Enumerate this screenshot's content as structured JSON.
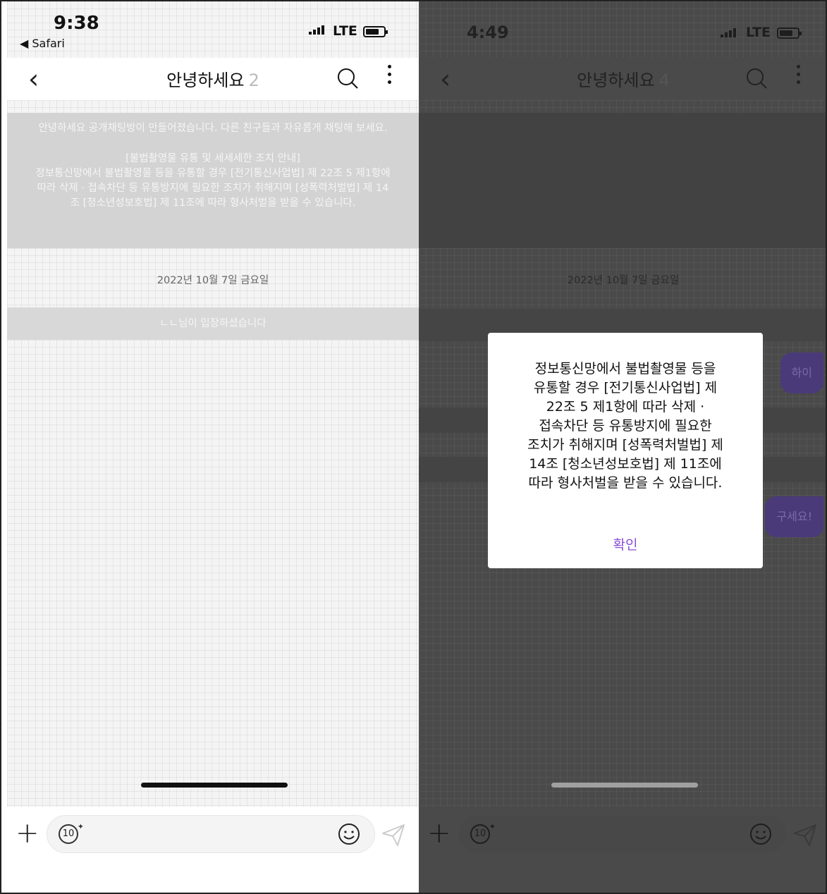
{
  "left_screen": {
    "status": {
      "time": "9:38",
      "back_app": "◀ Safari",
      "network": "LTE"
    },
    "nav": {
      "back_icon": "chevron-left-icon",
      "title": "안녕하세요",
      "member_count": "2"
    },
    "notice": {
      "line1": "안녕하세요 공개채팅방이 만들어졌습니다. 다른 친구들과 자유롭게 채팅해 보세요.",
      "heading": "[불법촬영물 유통 및 세세세한 조치 안내]",
      "body": "정보통신망에서 불법촬영물 등을 유통할 경우 [전기통신사업법] 제 22조 5 제1항에 따라 삭제 · 접속차단 등 유통방지에 필요한 조치가 취해지며 [성폭력처벌법] 제 14조 [청소년성보호법] 제 11조에 따라 형사처벌을 받을 수 있습니다."
    },
    "date_divider": "2022년 10월 7일 금요일",
    "join_message": "ㄴㄴ님이 입장하셨습니다",
    "input": {
      "gif_badge": "10"
    }
  },
  "right_screen": {
    "status": {
      "time": "4:49",
      "network": "LTE"
    },
    "nav": {
      "title": "안녕하세요",
      "member_count": "4"
    },
    "date_divider": "2022년 10월 7일 금요일",
    "bubbles": [
      "하이",
      "구세요!"
    ],
    "input": {
      "gif_badge": "10"
    },
    "dialog": {
      "lines": [
        "정보통신망에서 불법촬영물 등을",
        "유통할 경우 [전기통신사업법] 제",
        "22조 5 제1항에 따라 삭제 ·",
        "접속차단 등 유통방지에 필요한",
        "조치가 취해지며 [성폭력처벌법] 제",
        "14조 [청소년성보호법] 제 11조에",
        "따라 형사처벌을 받을 수 있습니다."
      ],
      "confirm_label": "확인"
    }
  },
  "colors": {
    "accent_purple": "#8a4fd8",
    "bubble_purple": "#4a3a7a"
  }
}
